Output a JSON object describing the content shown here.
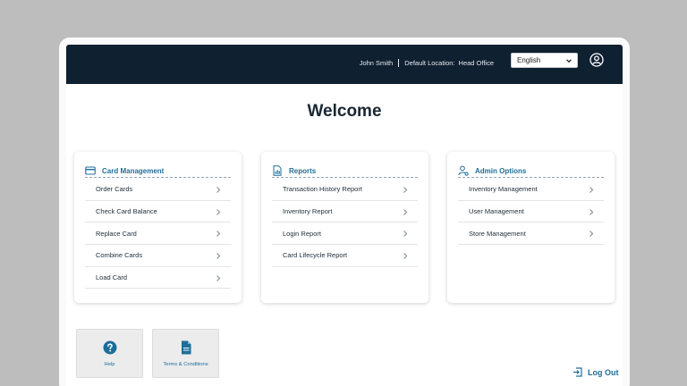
{
  "header": {
    "user_name": "John Smith",
    "location_label": "Default Location:",
    "location_value": "Head Office",
    "language": "English"
  },
  "page_title": "Welcome",
  "cards": {
    "card_management": {
      "title": "Card Management",
      "icon": "credit-card-icon",
      "items": [
        "Order Cards",
        "Check Card Balance",
        "Replace Card",
        "Combine Cards",
        "Load Card"
      ]
    },
    "reports": {
      "title": "Reports",
      "icon": "report-chart-icon",
      "items": [
        "Transaction History Report",
        "Inventory Report",
        "Login Report",
        "Card Lifecycle Report"
      ]
    },
    "admin_options": {
      "title": "Admin Options",
      "icon": "admin-user-icon",
      "items": [
        "Inventory Management",
        "User Management",
        "Store Management"
      ]
    }
  },
  "tiles": {
    "help": {
      "label": "Help",
      "icon": "help-circle-icon"
    },
    "terms": {
      "label": "Terms & Conditions",
      "icon": "document-icon"
    }
  },
  "logout_label": "Log Out",
  "colors": {
    "header_bg": "#0f2031",
    "accent": "#1d6e9a",
    "tile_bg": "#ececec"
  }
}
